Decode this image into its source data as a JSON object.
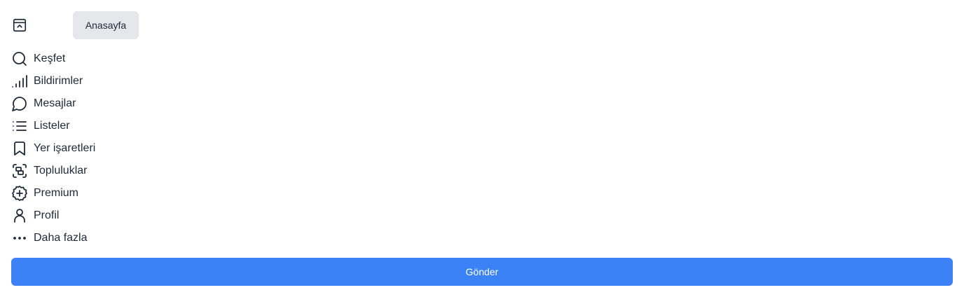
{
  "header": {
    "logo_icon": "app-logo-icon",
    "home_label": "Anasayfa"
  },
  "nav": {
    "items": [
      {
        "label": "Keşfet",
        "icon": "search-icon"
      },
      {
        "label": "Bildirimler",
        "icon": "signal-bars-icon"
      },
      {
        "label": "Mesajlar",
        "icon": "chat-bubble-icon"
      },
      {
        "label": "Listeler",
        "icon": "list-icon"
      },
      {
        "label": "Yer işaretleri",
        "icon": "bookmark-icon"
      },
      {
        "label": "Topluluklar",
        "icon": "communities-icon"
      },
      {
        "label": "Premium",
        "icon": "plus-badge-icon"
      },
      {
        "label": "Profil",
        "icon": "user-icon"
      },
      {
        "label": "Daha fazla",
        "icon": "more-dots-icon"
      }
    ]
  },
  "actions": {
    "send_label": "Gönder"
  },
  "colors": {
    "primary": "#3b82f6",
    "secondary_bg": "#e5e7eb",
    "text": "#1f2937"
  }
}
